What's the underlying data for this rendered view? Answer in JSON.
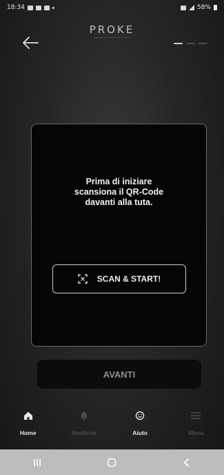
{
  "status_bar": {
    "time": "18:34",
    "battery": "58%"
  },
  "header": {
    "brand": "PROKE",
    "progress_steps": 3,
    "progress_active": 1
  },
  "card": {
    "line1": "Prima di iniziare",
    "line2": "scansiona il QR-Code",
    "line3": "davanti alla tuta.",
    "scan_label": "SCAN & START!"
  },
  "next_button": {
    "label": "AVANTI"
  },
  "bottom_nav": [
    {
      "label": "Home",
      "icon": "home-icon",
      "active": true
    },
    {
      "label": "Notifiche",
      "icon": "bell-icon",
      "active": false
    },
    {
      "label": "Aiuto",
      "icon": "help-icon",
      "active": true
    },
    {
      "label": "Menu",
      "icon": "menu-icon",
      "active": false
    }
  ],
  "colors": {
    "background": "#262626",
    "card": "#050505",
    "sysbar": "#bdbdbd",
    "inactive": "#4a4a4a"
  }
}
